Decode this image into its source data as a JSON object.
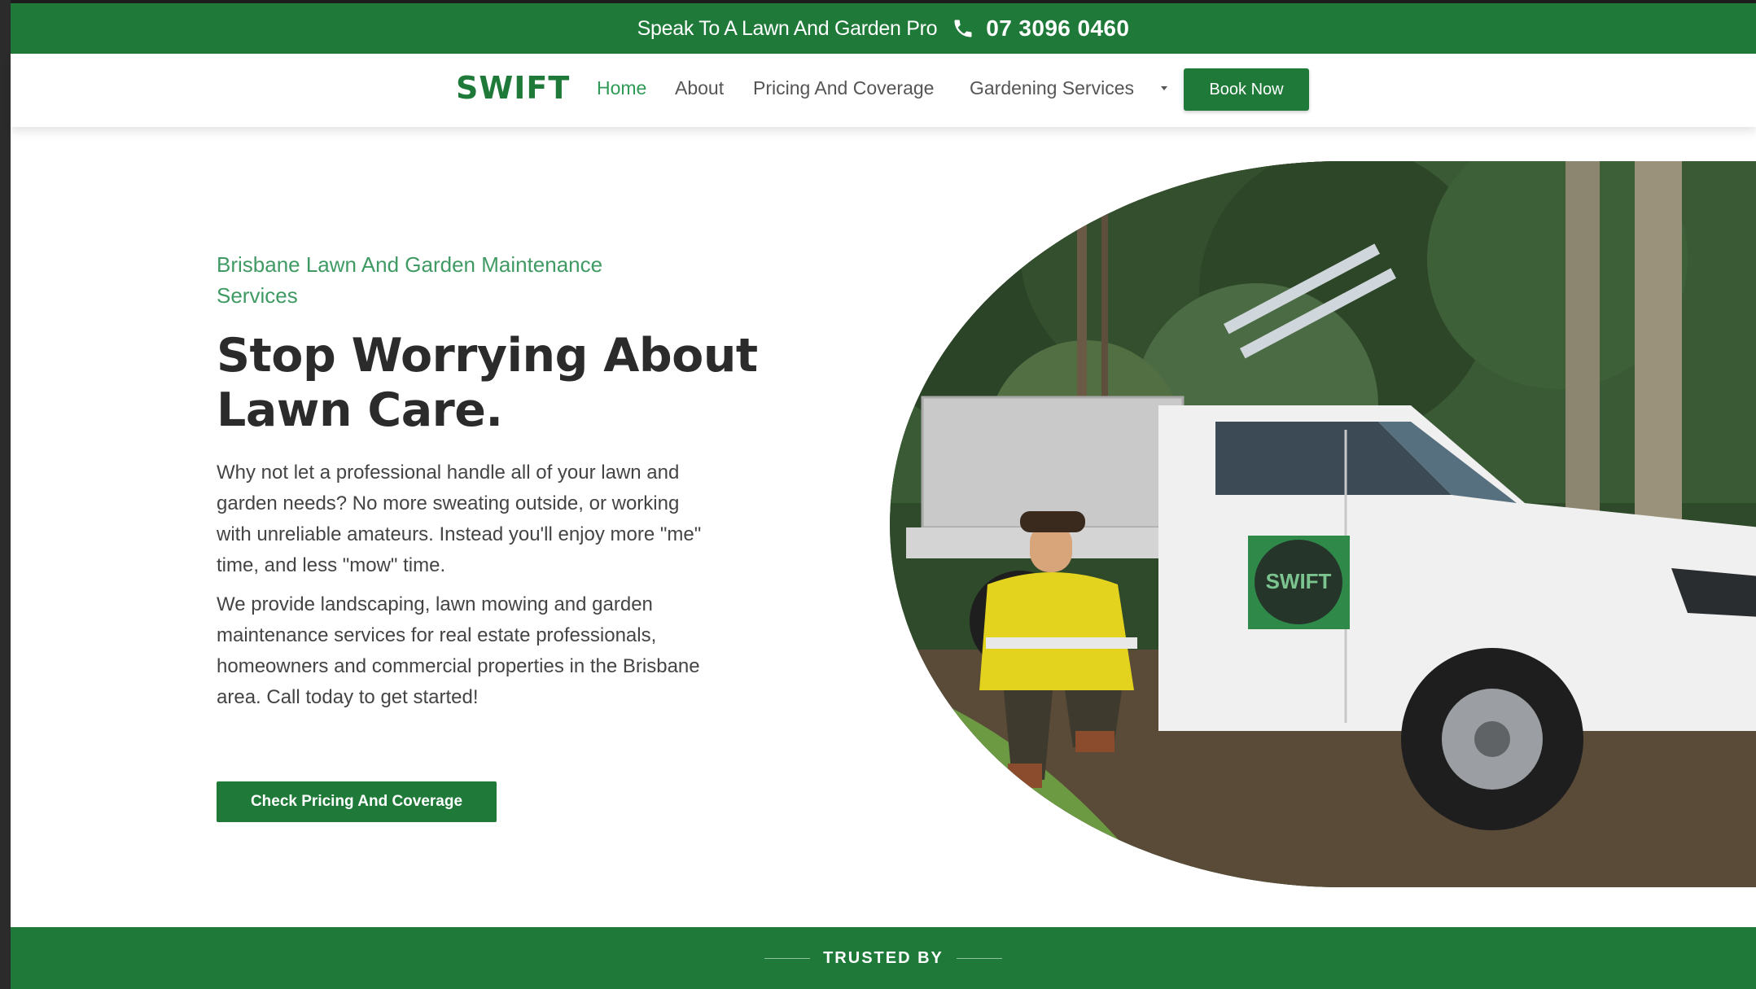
{
  "topbar": {
    "lead": "Speak To A Lawn And Garden Pro",
    "phone": "07 3096 0460",
    "phone_icon": "phone-icon"
  },
  "nav": {
    "logo": "SWIFT",
    "items": [
      {
        "label": "Home"
      },
      {
        "label": "About"
      },
      {
        "label": "Pricing And Coverage"
      },
      {
        "label": "Gardening Services"
      }
    ],
    "book": "Book Now"
  },
  "hero": {
    "eyebrow": "Brisbane Lawn And Garden Maintenance Services",
    "headline": "Stop Worrying About Lawn Care.",
    "para1": "Why not let a professional handle all of your lawn and garden needs? No more sweating outside, or working with unreliable amateurs. Instead you'll enjoy more \"me\" time, and less \"mow\" time.",
    "para2": "We provide landscaping, lawn mowing and garden maintenance services for real estate professionals, homeowners and commercial properties in the Brisbane area. Call today to get started!",
    "cta": "Check Pricing And Coverage",
    "photo_logo": "SWIFT"
  },
  "trusted": {
    "label": "TRUSTED BY"
  },
  "colors": {
    "brand_green": "#1f7a3a",
    "accent_green": "#3f9a64"
  }
}
